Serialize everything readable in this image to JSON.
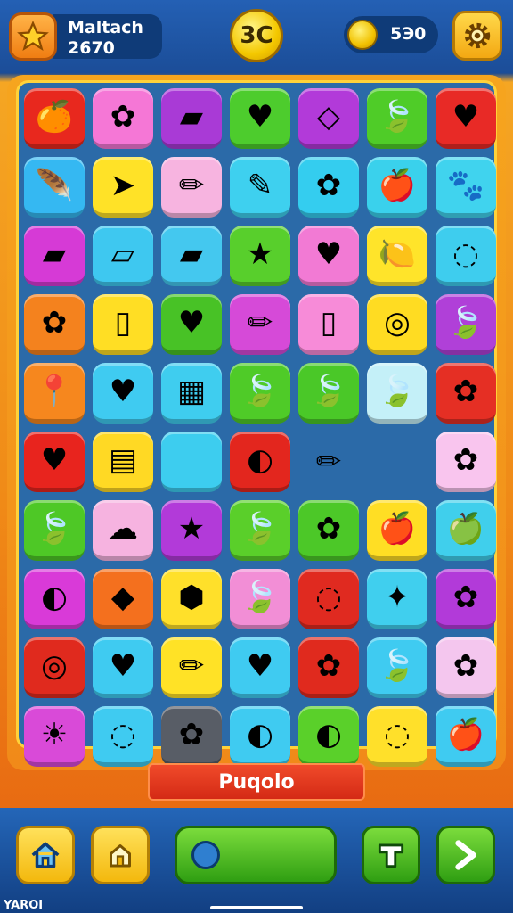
{
  "header": {
    "player_name": "Maltach",
    "player_score": "2670",
    "level_badge": "3C",
    "coins": "5Э0",
    "star_icon": "star-icon",
    "gear_icon": "gear-icon"
  },
  "board": {
    "rows": [
      [
        {
          "c": "#e8281e",
          "i": "🍊"
        },
        {
          "c": "#f577d6",
          "i": "✿"
        },
        {
          "c": "#a93ad6",
          "i": "▰"
        },
        {
          "c": "#4dcc2d",
          "i": "♥"
        },
        {
          "c": "#b23ad9",
          "i": "◇"
        },
        {
          "c": "#4fcc28",
          "i": "🍃"
        },
        {
          "c": "#e82a26",
          "i": "♥"
        }
      ],
      [
        {
          "c": "#35b8f2",
          "i": "🪶"
        },
        {
          "c": "#ffe227",
          "i": "➤"
        },
        {
          "c": "#f7b4e0",
          "i": "✏"
        },
        {
          "c": "#3ed0ef",
          "i": "✎"
        },
        {
          "c": "#34cdef",
          "i": "✿"
        },
        {
          "c": "#3ad1ec",
          "i": "🍎"
        },
        {
          "c": "#40d3ee",
          "i": "🐾"
        }
      ],
      [
        {
          "c": "#d63ad6",
          "i": "▰"
        },
        {
          "c": "#3ec8f0",
          "i": "▱"
        },
        {
          "c": "#44c8ef",
          "i": "▰"
        },
        {
          "c": "#58cf2c",
          "i": "★"
        },
        {
          "c": "#f27ad4",
          "i": "♥"
        },
        {
          "c": "#ffe42a",
          "i": "🍋"
        },
        {
          "c": "#3ecdee",
          "i": "◌"
        }
      ],
      [
        {
          "c": "#f4821e",
          "i": "✿"
        },
        {
          "c": "#ffde24",
          "i": "▯"
        },
        {
          "c": "#48c226",
          "i": "♥"
        },
        {
          "c": "#d64ad8",
          "i": "✏"
        },
        {
          "c": "#f78bd8",
          "i": "▯"
        },
        {
          "c": "#ffdc22",
          "i": "◎"
        },
        {
          "c": "#b040d8",
          "i": "🍃"
        }
      ],
      [
        {
          "c": "#f6871e",
          "i": "📍"
        },
        {
          "c": "#3fcbf1",
          "i": "♥"
        },
        {
          "c": "#3fcdef",
          "i": "▦"
        },
        {
          "c": "#4fcb28",
          "i": "🍃"
        },
        {
          "c": "#4ac828",
          "i": "🍃"
        },
        {
          "c": "#c4f0f8",
          "i": "🍃"
        },
        {
          "c": "#e52f24",
          "i": "✿"
        }
      ],
      [
        {
          "c": "#e8241e",
          "i": "♥"
        },
        {
          "c": "#ffd924",
          "i": "▤"
        },
        {
          "c": "#3dcdef",
          "i": ""
        },
        {
          "c": "#e3261e",
          "i": "◐"
        },
        {
          "c": "empty",
          "i": "✏"
        },
        {
          "c": "empty",
          "i": ""
        },
        {
          "c": "#f9c5ee",
          "i": "✿"
        }
      ],
      [
        {
          "c": "#4ec826",
          "i": "🍃"
        },
        {
          "c": "#f6b3e0",
          "i": "☁"
        },
        {
          "c": "#b23ad9",
          "i": "★"
        },
        {
          "c": "#5acf2a",
          "i": "🍃"
        },
        {
          "c": "#4cc828",
          "i": "✿"
        },
        {
          "c": "#ffde24",
          "i": "🍎"
        },
        {
          "c": "#40cfec",
          "i": "🍏"
        }
      ],
      [
        {
          "c": "#d93ad8",
          "i": "◐"
        },
        {
          "c": "#f4701e",
          "i": "◆"
        },
        {
          "c": "#ffe02a",
          "i": "⬢"
        },
        {
          "c": "#f28ed6",
          "i": "🍃"
        },
        {
          "c": "#e02a20",
          "i": "◌"
        },
        {
          "c": "#40cfee",
          "i": "✦"
        },
        {
          "c": "#b23ad9",
          "i": "✿"
        }
      ],
      [
        {
          "c": "#e02a1e",
          "i": "◎"
        },
        {
          "c": "#3fcbf1",
          "i": "♥"
        },
        {
          "c": "#ffe226",
          "i": "✏"
        },
        {
          "c": "#3fcbf1",
          "i": "♥"
        },
        {
          "c": "#e02a1e",
          "i": "✿"
        },
        {
          "c": "#3fcbf1",
          "i": "🍃"
        },
        {
          "c": "#f4c6ee",
          "i": "✿"
        }
      ],
      [
        {
          "c": "#d94ad8",
          "i": "☀"
        },
        {
          "c": "#3fcbf1",
          "i": "◌"
        },
        {
          "c": "#585d66",
          "i": "✿"
        },
        {
          "c": "#3fcbf1",
          "i": "◐"
        },
        {
          "c": "#5ad02a",
          "i": "◐"
        },
        {
          "c": "#ffe02a",
          "i": "◌"
        },
        {
          "c": "#3fcbf1",
          "i": "🍎"
        }
      ]
    ]
  },
  "puzzle_label": "Puqolo",
  "bottom": {
    "home_icon": "home-icon",
    "house_icon": "house-icon",
    "timer_icon": "timer-icon",
    "tool_icon": "tool-icon",
    "next_icon": "arrow-right-icon"
  },
  "footer_text": "YAROI"
}
